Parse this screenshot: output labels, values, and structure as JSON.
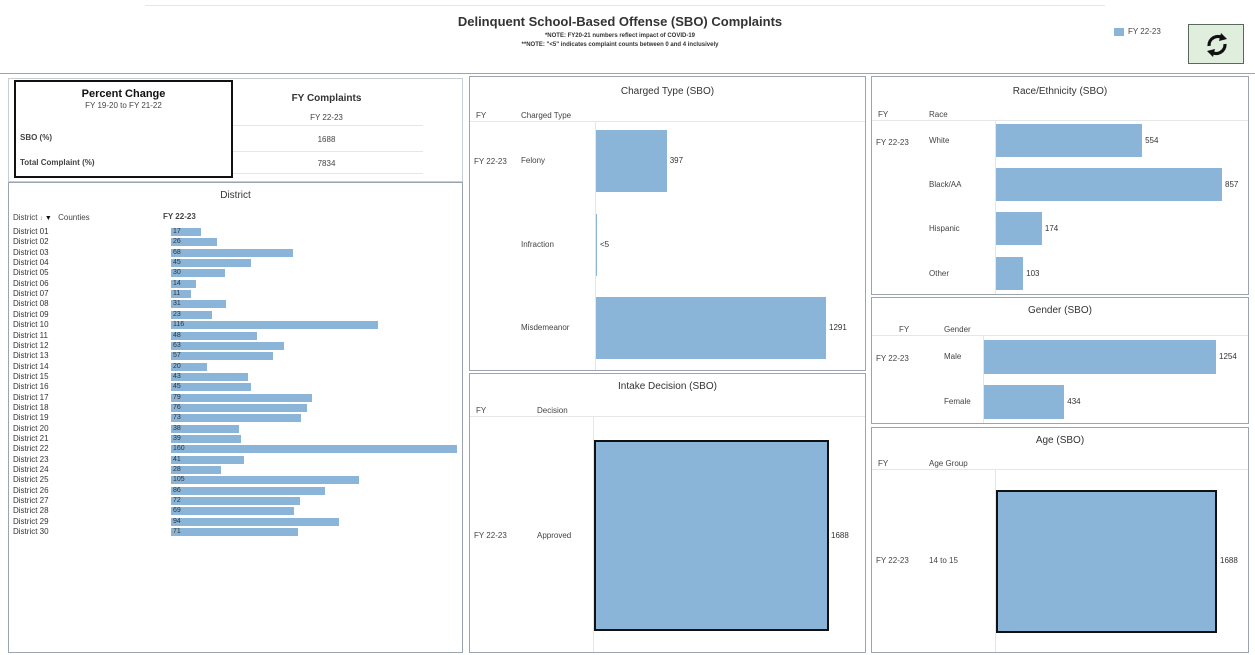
{
  "header": {
    "title": "Delinquent School-Based Offense (SBO) Complaints",
    "note1": "*NOTE: FY20-21 numbers reflect impact of COVID-19",
    "note2": "**NOTE: \"<5\" indicates complaint counts between 0 and 4 inclusively",
    "legend_label": "FY 22-23",
    "legend_color": "#8ab5d9"
  },
  "percent_change": {
    "title": "Percent Change",
    "subtitle": "FY 19-20 to FY 21-22",
    "fy_header": "FY Complaints",
    "fy_sub": "FY 22-23",
    "rows": [
      {
        "label": "SBO (%)",
        "value": "1688"
      },
      {
        "label": "Total Complaint (%)",
        "value": "7834"
      }
    ]
  },
  "district": {
    "title": "District",
    "col1": "District",
    "col2": "Counties",
    "col3": "FY 22-23",
    "max": 160
  },
  "charged": {
    "title": "Charged Type (SBO)",
    "col_fy": "FY",
    "col_type": "Charged Type",
    "fy": "FY 22-23"
  },
  "intake": {
    "title": "Intake Decision (SBO)",
    "col_fy": "FY",
    "col_decision": "Decision",
    "fy": "FY 22-23",
    "label": "Approved",
    "value": "1688"
  },
  "race": {
    "title": "Race/Ethnicity (SBO)",
    "col_fy": "FY",
    "col_race": "Race",
    "fy": "FY 22-23"
  },
  "gender": {
    "title": "Gender (SBO)",
    "col_fy": "FY",
    "col_gender": "Gender",
    "fy": "FY 22-23"
  },
  "age": {
    "title": "Age (SBO)",
    "col_fy": "FY",
    "col_age": "Age Group",
    "fy": "FY 22-23",
    "label": "14 to 15",
    "value": "1688"
  },
  "chart_data": [
    {
      "type": "bar",
      "title": "District",
      "categories": [
        "District 01",
        "District 02",
        "District 03",
        "District 04",
        "District 05",
        "District 06",
        "District 07",
        "District 08",
        "District 09",
        "District 10",
        "District 11",
        "District 12",
        "District 13",
        "District 14",
        "District 15",
        "District 16",
        "District 17",
        "District 18",
        "District 19",
        "District 20",
        "District 21",
        "District 22",
        "District 23",
        "District 24",
        "District 25",
        "District 26",
        "District 27",
        "District 28",
        "District 29",
        "District 30"
      ],
      "series": [
        {
          "name": "FY 22-23",
          "values": [
            17,
            26,
            68,
            45,
            30,
            14,
            11,
            31,
            23,
            116,
            48,
            63,
            57,
            20,
            43,
            45,
            79,
            76,
            73,
            38,
            39,
            160,
            41,
            28,
            105,
            86,
            72,
            69,
            94,
            71
          ]
        }
      ]
    },
    {
      "type": "bar",
      "title": "Charged Type (SBO)",
      "categories": [
        "Felony",
        "Infraction",
        "Misdemeanor"
      ],
      "values": [
        397,
        0,
        1291
      ],
      "labels": [
        "397",
        "<5",
        "1291"
      ],
      "max": 1291
    },
    {
      "type": "bar",
      "title": "Race/Ethnicity (SBO)",
      "categories": [
        "White",
        "Black/AA",
        "Hispanic",
        "Other"
      ],
      "values": [
        554,
        857,
        174,
        103
      ],
      "labels": [
        "554",
        "857",
        "174",
        "103"
      ],
      "max": 857
    },
    {
      "type": "bar",
      "title": "Gender (SBO)",
      "categories": [
        "Male",
        "Female"
      ],
      "values": [
        1254,
        434
      ],
      "labels": [
        "1254",
        "434"
      ],
      "max": 1254
    }
  ]
}
